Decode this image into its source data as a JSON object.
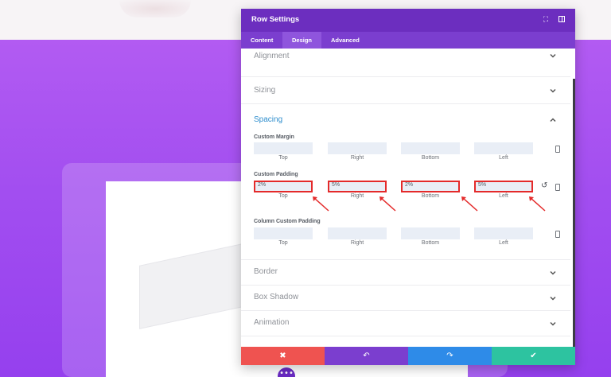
{
  "modal": {
    "title": "Row Settings",
    "expand_icon": "expand-icon",
    "split_icon": "split-view-icon"
  },
  "tabs": [
    {
      "label": "Content"
    },
    {
      "label": "Design",
      "active": true
    },
    {
      "label": "Advanced"
    }
  ],
  "sections": {
    "alignment": "Alignment",
    "sizing": "Sizing",
    "spacing": "Spacing",
    "border": "Border",
    "box_shadow": "Box Shadow",
    "animation": "Animation"
  },
  "spacing": {
    "custom_margin": {
      "label": "Custom Margin",
      "fields": [
        {
          "sub": "Top",
          "value": ""
        },
        {
          "sub": "Right",
          "value": ""
        },
        {
          "sub": "Bottom",
          "value": ""
        },
        {
          "sub": "Left",
          "value": ""
        }
      ]
    },
    "custom_padding": {
      "label": "Custom Padding",
      "fields": [
        {
          "sub": "Top",
          "value": "2%"
        },
        {
          "sub": "Right",
          "value": "5%"
        },
        {
          "sub": "Bottom",
          "value": "2%"
        },
        {
          "sub": "Left",
          "value": "5%"
        }
      ]
    },
    "column_custom_padding": {
      "label": "Column Custom Padding",
      "fields": [
        {
          "sub": "Top",
          "value": ""
        },
        {
          "sub": "Right",
          "value": ""
        },
        {
          "sub": "Bottom",
          "value": ""
        },
        {
          "sub": "Left",
          "value": ""
        }
      ]
    }
  },
  "footer": {
    "cancel": "✖",
    "undo": "↶",
    "redo": "↷",
    "save": "✔"
  },
  "colors": {
    "header": "#6c2ebf",
    "tabs": "#7b3ecf",
    "active_section": "#2f8ecd",
    "highlight": "#e42a2a",
    "cancel": "#ef5350",
    "redo": "#2e8be8",
    "save": "#2dc3a0"
  }
}
